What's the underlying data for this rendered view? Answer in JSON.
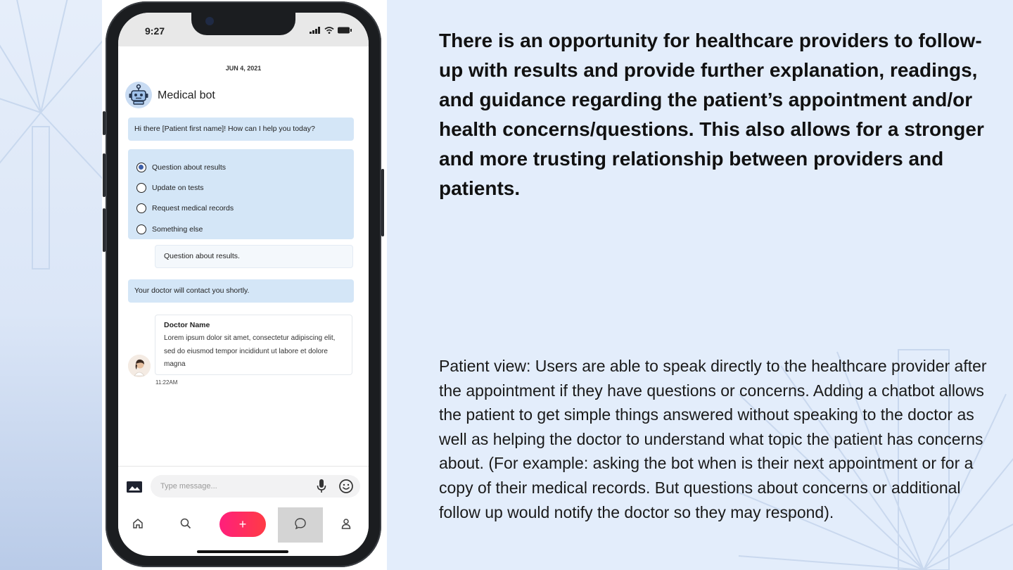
{
  "phone": {
    "status_time": "9:27",
    "chat_date": "JUN 4, 2021",
    "bot_name": "Medical bot",
    "greeting": "Hi there [Patient first name]! How can I help you today?",
    "options": [
      {
        "label": "Question about results",
        "selected": true
      },
      {
        "label": "Update on tests",
        "selected": false
      },
      {
        "label": "Request medical records",
        "selected": false
      },
      {
        "label": "Something else",
        "selected": false
      }
    ],
    "user_reply": "Question about results.",
    "bot_notice": "Your doctor will contact you shortly.",
    "doctor_message": {
      "name": "Doctor Name",
      "text": "Lorem ipsum dolor sit amet, consectetur adipiscing elit, sed do eiusmod tempor incididunt ut labore et dolore magna",
      "time": "11:22AM"
    },
    "input_placeholder": "Type message...",
    "nav": {
      "items": [
        "home-icon",
        "search-icon",
        "add-button",
        "chat-icon",
        "profile-icon"
      ],
      "add_label": "+",
      "active": "chat-icon"
    }
  },
  "headline": "There is an opportunity for healthcare providers to follow-up with results and provide further explanation, readings, and guidance regarding the patient’s appointment and/or health concerns/questions. This also allows for a stronger and more trusting relationship between providers and patients.",
  "description": "Patient view: Users are able to speak directly to the healthcare provider after the appointment if they have questions or concerns. Adding a chatbot allows the patient to get simple things answered without speaking to the doctor as well as helping the doctor to understand what topic the patient has concerns about. (For example: asking the bot when is their next appointment or for a copy of their medical records. But questions about concerns or additional follow up would notify the doctor so they may respond).",
  "colors": {
    "background": "#e3edfb",
    "bubble": "#d4e6f7",
    "add_button": "#ff1f7c",
    "radio_selected": "#3d5fa8"
  }
}
